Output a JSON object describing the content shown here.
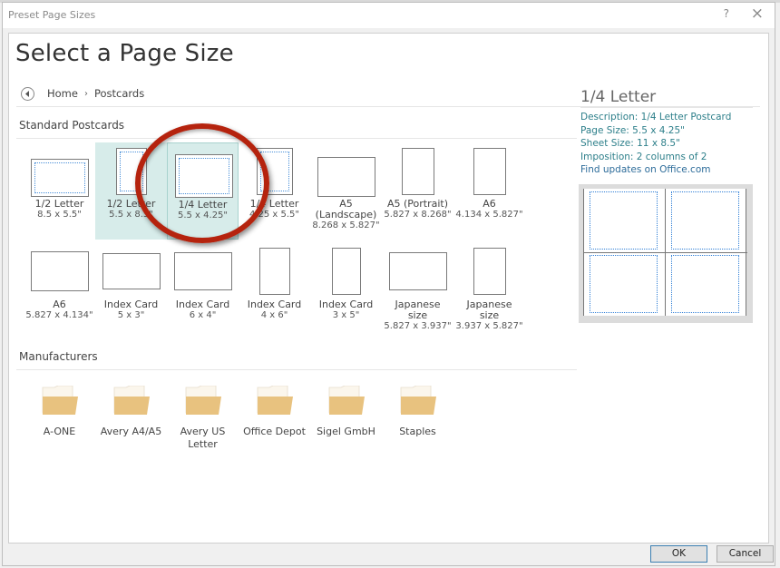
{
  "window": {
    "title": "Preset Page Sizes",
    "help_label": "?",
    "close_label": "×"
  },
  "header": {
    "title": "Select a Page Size"
  },
  "breadcrumb": {
    "items": [
      "Home",
      "Postcards"
    ],
    "separator": "›"
  },
  "sections": {
    "standard_label": "Standard Postcards",
    "manufacturers_label": "Manufacturers"
  },
  "postcards": [
    {
      "name": "1/2 Letter",
      "size": "8.5 x 5.5\"",
      "state": "normal"
    },
    {
      "name": "1/2 Letter",
      "size": "5.5 x 8.5\"",
      "state": "hover"
    },
    {
      "name": "1/4 Letter",
      "size": "5.5 x 4.25\"",
      "state": "selected"
    },
    {
      "name": "1/4 Letter",
      "size": "4.25 x 5.5\"",
      "state": "normal"
    },
    {
      "name": "A5 (Landscape)",
      "size": "8.268 x 5.827\"",
      "state": "normal"
    },
    {
      "name": "A5 (Portrait)",
      "size": "5.827 x 8.268\"",
      "state": "normal"
    },
    {
      "name": "A6",
      "size": "4.134 x 5.827\"",
      "state": "normal"
    },
    {
      "name": "A6",
      "size": "5.827 x 4.134\"",
      "state": "normal"
    },
    {
      "name": "Index Card",
      "size": "5 x 3\"",
      "state": "normal"
    },
    {
      "name": "Index Card",
      "size": "6 x 4\"",
      "state": "normal"
    },
    {
      "name": "Index Card",
      "size": "4 x 6\"",
      "state": "normal"
    },
    {
      "name": "Index Card",
      "size": "3 x 5\"",
      "state": "normal"
    },
    {
      "name": "Japanese size",
      "size": "5.827 x 3.937\"",
      "state": "normal"
    },
    {
      "name": "Japanese size",
      "size": "3.937 x 5.827\"",
      "state": "normal"
    }
  ],
  "manufacturers": [
    "A-ONE",
    "Avery A4/A5",
    "Avery US Letter",
    "Office Depot",
    "Sigel GmbH",
    "Staples"
  ],
  "details": {
    "title": "1/4 Letter",
    "description": "Description: 1/4 Letter Postcard",
    "page_size": "Page Size: 5.5 x 4.25\"",
    "sheet_size": "Sheet Size: 11 x 8.5\"",
    "imposition": "Imposition: 2 columns of 2",
    "updates_link": "Find updates on Office.com"
  },
  "buttons": {
    "ok": "OK",
    "cancel": "Cancel"
  },
  "colors": {
    "selection": "#d7ecea",
    "detail_text": "#2d7f8a",
    "annotation": "#b5230e",
    "folder": "#e8c27f"
  }
}
